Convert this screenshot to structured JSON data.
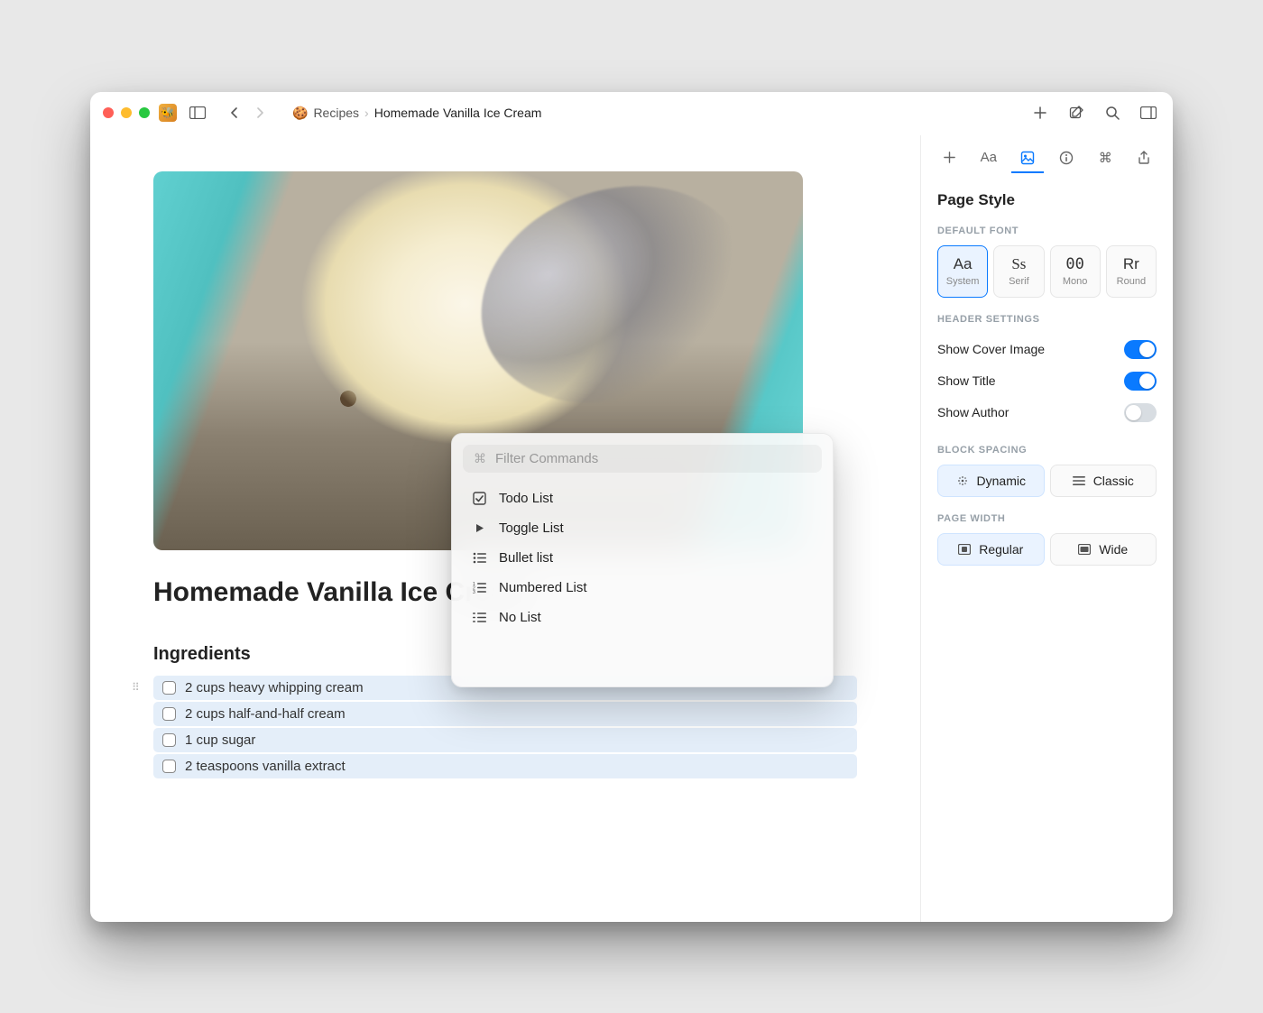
{
  "breadcrumb": {
    "parent": "Recipes",
    "current": "Homemade Vanilla Ice Cream"
  },
  "page": {
    "title": "Homemade Vanilla Ice Cream",
    "section_heading": "Ingredients",
    "ingredients": [
      "2 cups heavy whipping cream",
      "2 cups half-and-half cream",
      "1 cup sugar",
      "2 teaspoons vanilla extract"
    ]
  },
  "command_popup": {
    "placeholder": "Filter Commands",
    "items": [
      {
        "icon": "checkbox-icon",
        "label": "Todo List"
      },
      {
        "icon": "play-icon",
        "label": "Toggle List"
      },
      {
        "icon": "bullet-list-icon",
        "label": "Bullet list"
      },
      {
        "icon": "numbered-list-icon",
        "label": "Numbered List"
      },
      {
        "icon": "no-list-icon",
        "label": "No List"
      }
    ]
  },
  "inspector": {
    "title": "Page Style",
    "sections": {
      "default_font_label": "DEFAULT FONT",
      "fonts": [
        {
          "sample": "Aa",
          "name": "System",
          "selected": true,
          "style": ""
        },
        {
          "sample": "Ss",
          "name": "Serif",
          "selected": false,
          "style": "serif"
        },
        {
          "sample": "00",
          "name": "Mono",
          "selected": false,
          "style": "mono"
        },
        {
          "sample": "Rr",
          "name": "Round",
          "selected": false,
          "style": "round"
        }
      ],
      "header_settings_label": "HEADER SETTINGS",
      "toggles": [
        {
          "label": "Show Cover Image",
          "on": true
        },
        {
          "label": "Show Title",
          "on": true
        },
        {
          "label": "Show Author",
          "on": false
        }
      ],
      "block_spacing_label": "BLOCK SPACING",
      "spacing_options": [
        {
          "label": "Dynamic",
          "selected": true
        },
        {
          "label": "Classic",
          "selected": false
        }
      ],
      "page_width_label": "PAGE WIDTH",
      "width_options": [
        {
          "label": "Regular",
          "selected": true
        },
        {
          "label": "Wide",
          "selected": false
        }
      ]
    }
  }
}
